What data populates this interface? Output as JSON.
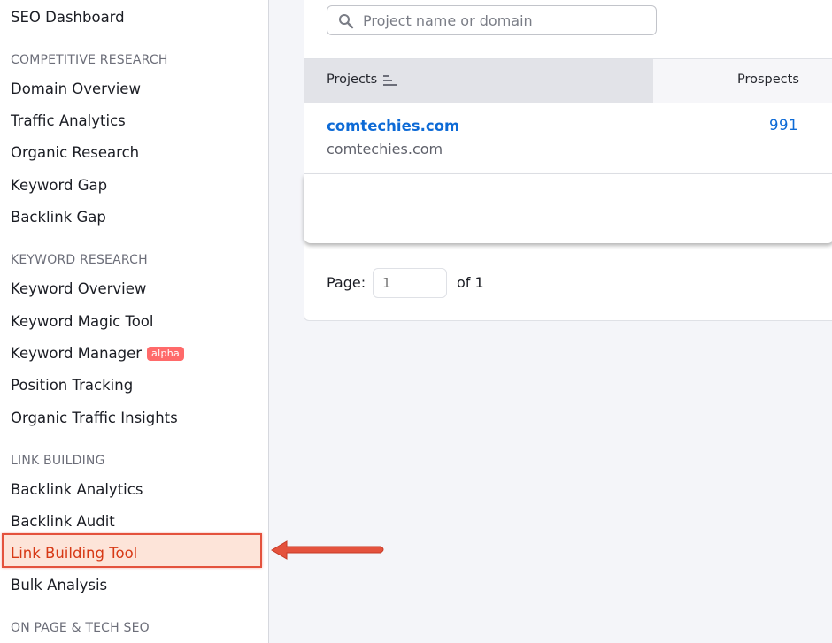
{
  "sidebar": {
    "top_item": "SEO Dashboard",
    "sections": [
      {
        "heading": "COMPETITIVE RESEARCH",
        "items": [
          "Domain Overview",
          "Traffic Analytics",
          "Organic Research",
          "Keyword Gap",
          "Backlink Gap"
        ]
      },
      {
        "heading": "KEYWORD RESEARCH",
        "items": [
          "Keyword Overview",
          "Keyword Magic Tool",
          "Keyword Manager",
          "Position Tracking",
          "Organic Traffic Insights"
        ],
        "badge": "alpha"
      },
      {
        "heading": "LINK BUILDING",
        "items": [
          "Backlink Analytics",
          "Backlink Audit",
          "Link Building Tool",
          "Bulk Analysis"
        ]
      },
      {
        "heading": "ON PAGE & TECH SEO",
        "items": []
      }
    ],
    "highlighted_item": "Link Building Tool"
  },
  "search": {
    "placeholder": "Project name or domain",
    "value": ""
  },
  "table": {
    "columns": [
      "Projects",
      "Prospects"
    ],
    "rows": [
      {
        "name": "comtechies.com",
        "domain": "comtechies.com",
        "prospects": "991"
      }
    ]
  },
  "pagination": {
    "label": "Page:",
    "current_placeholder": "1",
    "of_label": "of 1"
  },
  "colors": {
    "accent_link": "#0d6ad6",
    "highlight_border": "#e4523d",
    "highlight_text": "#d73916",
    "badge": "#ff6a6a"
  },
  "icons": [
    "search-icon",
    "sort-icon",
    "arrow-left-icon"
  ]
}
